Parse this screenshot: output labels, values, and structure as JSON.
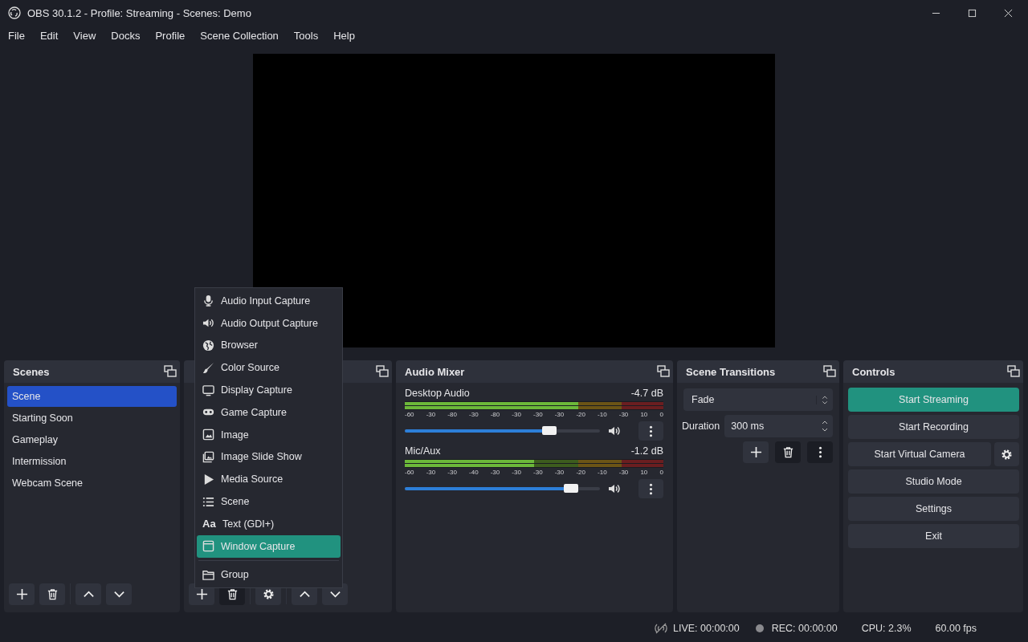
{
  "window": {
    "title": "OBS 30.1.2 - Profile: Streaming - Scenes: Demo"
  },
  "menu_bar": [
    "File",
    "Edit",
    "View",
    "Docks",
    "Profile",
    "Scene Collection",
    "Tools",
    "Help"
  ],
  "scenes": {
    "title": "Scenes",
    "items": [
      {
        "label": "Scene",
        "selected": true
      },
      {
        "label": "Starting Soon",
        "selected": false
      },
      {
        "label": "Gameplay",
        "selected": false
      },
      {
        "label": "Intermission",
        "selected": false
      },
      {
        "label": "Webcam Scene",
        "selected": false
      }
    ]
  },
  "add_source_menu": [
    {
      "label": "Audio Input Capture",
      "selected": false
    },
    {
      "label": "Audio Output Capture",
      "selected": false
    },
    {
      "label": "Browser",
      "selected": false
    },
    {
      "label": "Color Source",
      "selected": false
    },
    {
      "label": "Display Capture",
      "selected": false
    },
    {
      "label": "Game Capture",
      "selected": false
    },
    {
      "label": "Image",
      "selected": false
    },
    {
      "label": "Image Slide Show",
      "selected": false
    },
    {
      "label": "Media Source",
      "selected": false
    },
    {
      "label": "Scene",
      "selected": false
    },
    {
      "label": "Text (GDI+)",
      "glyph": "Aa",
      "selected": false
    },
    {
      "label": "Window Capture",
      "selected": true
    },
    {
      "label": "Group",
      "separator_before": true,
      "selected": false
    }
  ],
  "audio_mixer": {
    "title": "Audio Mixer",
    "channels": [
      {
        "name": "Desktop Audio",
        "reading": "-4.7 dB",
        "meter": {
          "level": 0.67
        },
        "level": 0.74,
        "ticks": [
          "-60",
          "-30",
          "-80",
          "-30",
          "-80",
          "-30",
          "-30",
          "-30",
          "-20",
          "-10",
          "-30",
          "10",
          "0"
        ]
      },
      {
        "name": "Mic/Aux",
        "reading": "-1.2 dB",
        "meter": {
          "level": 0.5
        },
        "level": 0.85,
        "ticks": [
          "-60",
          "-30",
          "-30",
          "-40",
          "-30",
          "-30",
          "-30",
          "-30",
          "-20",
          "-10",
          "-30",
          "10",
          "0"
        ]
      }
    ]
  },
  "scene_transitions": {
    "title": "Scene Transitions",
    "transition": "Fade",
    "duration_label": "Duration",
    "duration": "300 ms"
  },
  "controls": {
    "title": "Controls",
    "buttons": [
      {
        "label": "Start Streaming",
        "highlighted": true,
        "settings": false
      },
      {
        "label": "Start Recording",
        "highlighted": false,
        "settings": false
      },
      {
        "label": "Start Virtual Camera",
        "highlighted": false,
        "settings": true
      },
      {
        "label": "Studio Mode",
        "highlighted": false,
        "settings": false
      },
      {
        "label": "Settings",
        "highlighted": false,
        "settings": false
      },
      {
        "label": "Exit",
        "highlighted": false,
        "settings": false
      }
    ]
  },
  "status_bar": {
    "live": "LIVE: 00:00:00",
    "rec": "REC: 00:00:00",
    "cpu": "CPU: 2.3%",
    "fps": "60.00 fps"
  }
}
